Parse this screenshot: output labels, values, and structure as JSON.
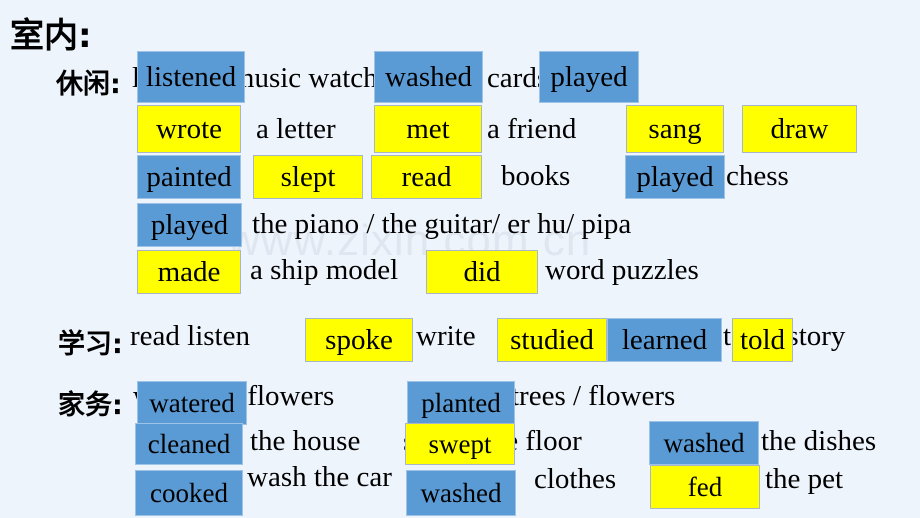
{
  "slide": {
    "background_color": "#eef4fc",
    "blue_color": "#5b9bd5",
    "yellow_color": "#ffff00",
    "watermark": "www.zixin.com.cn",
    "headings": {
      "indoor": "室内:",
      "leisure": "休闲:",
      "study": "学习:",
      "chores": "家务:"
    },
    "base_text": {
      "leisure_row1": "listen to music    watch TV     play cards",
      "leisure_row2_a": "a letter",
      "leisure_row2_b": "a friend",
      "leisure_row3_books": "books",
      "leisure_row3_chess": "chess",
      "leisure_row4": "the piano / the guitar/ er hu/ pipa",
      "leisure_row5_a": "a ship model",
      "leisure_row5_b": "word puzzles",
      "study_row": "read    listen",
      "study_write": "write",
      "study_tell": "tell a story",
      "chores_row1_a": "water the flowers",
      "chores_row1_b": "trees / flowers",
      "chores_row2_a": "the house",
      "chores_row2_b": "sweep the floor",
      "chores_row2_c": "the dishes",
      "chores_row3_a": "wash the car",
      "chores_row3_b": "clothes",
      "chores_row3_c": "the pet"
    },
    "boxes": {
      "listened": "listened",
      "washed_tv": "washed",
      "played_cards": "played",
      "wrote": "wrote",
      "met": "met",
      "sang": "sang",
      "draw": "draw",
      "painted": "painted",
      "slept": "slept",
      "read": "read",
      "played_chess": "played",
      "played_piano": "played",
      "made": "made",
      "did": "did",
      "spoke": "spoke",
      "studied": "studied",
      "learned": "learned",
      "told": "told",
      "watered": "watered",
      "planted": "planted",
      "cleaned": "cleaned",
      "swept": "swept",
      "washed_dishes": "washed",
      "cooked": "cooked",
      "washed_clothes": "washed",
      "fed": "fed"
    }
  }
}
